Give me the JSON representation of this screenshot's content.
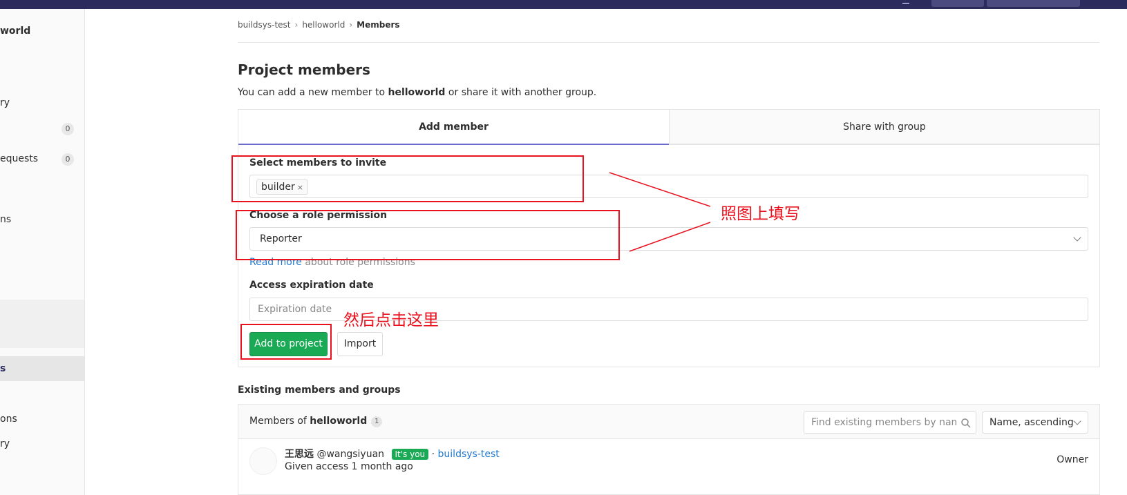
{
  "sidebar": {
    "project_title": "world",
    "items": [
      {
        "label": "ry"
      },
      {
        "label": "",
        "badge": "0"
      },
      {
        "label": "equests",
        "badge": "0"
      },
      {
        "label": "ns"
      },
      {
        "label": "s"
      },
      {
        "label": "ons"
      },
      {
        "label": "ry"
      }
    ]
  },
  "breadcrumb": {
    "items": [
      "buildsys-test",
      "helloworld",
      "Members"
    ],
    "separator": "›"
  },
  "page": {
    "title": "Project members",
    "subtitle_prefix": "You can add a new member to ",
    "subtitle_project": "helloworld",
    "subtitle_suffix": " or share it with another group."
  },
  "tabs": {
    "add_member": "Add member",
    "share_with_group": "Share with group"
  },
  "form": {
    "invite_label": "Select members to invite",
    "invite_token": "builder",
    "invite_token_remove": "×",
    "role_label": "Choose a role permission",
    "role_value": "Reporter",
    "read_more_link": "Read more",
    "read_more_suffix": " about role permissions",
    "expiration_label": "Access expiration date",
    "expiration_placeholder": "Expiration date",
    "add_button": "Add to project",
    "import_button": "Import"
  },
  "existing": {
    "heading": "Existing members and groups",
    "members_of_prefix": "Members of ",
    "members_of_project": "helloworld",
    "count": "1",
    "search_placeholder": "Find existing members by name",
    "sort_value": "Name, ascending",
    "members": [
      {
        "name": "王思远",
        "username": "@wangsiyuan",
        "badge": "It's you",
        "separator": "·",
        "group": "buildsys-test",
        "access": "Given access 1 month ago",
        "role": "Owner"
      }
    ]
  },
  "annotations": {
    "fill_note": "照图上填写",
    "click_note": "然后点击这里",
    "color": "#e8111d"
  },
  "colors": {
    "topbar": "#2b2b5e",
    "primary_button": "#1aaa55",
    "link": "#1f78d1",
    "active_tab": "#6b6bcf"
  }
}
